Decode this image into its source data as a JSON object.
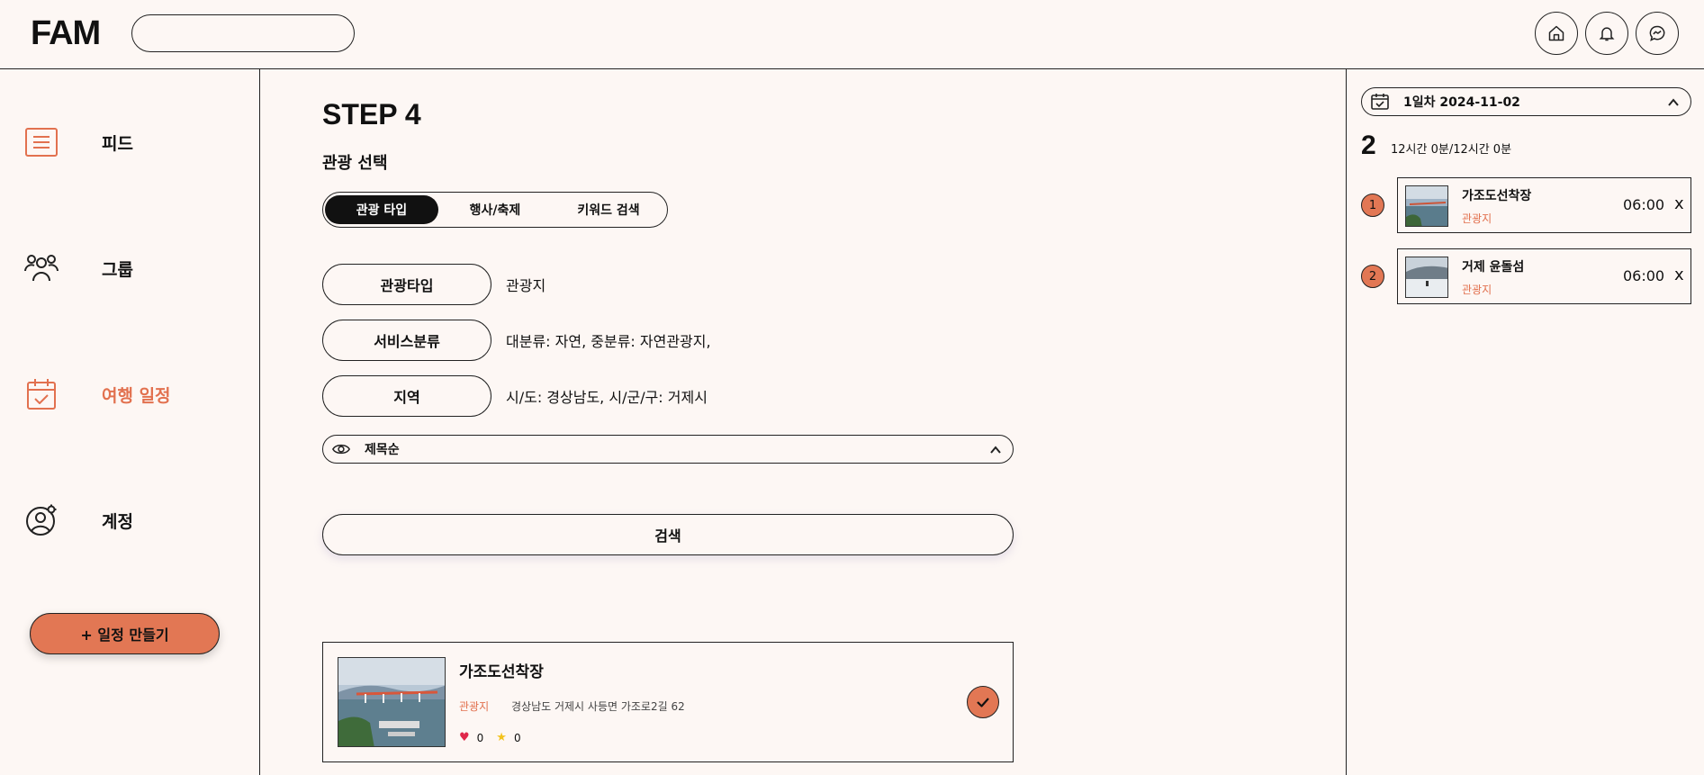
{
  "header": {
    "logo": "FAM",
    "search_placeholder": "",
    "icons": [
      "home-icon",
      "bell-icon",
      "messenger-icon"
    ]
  },
  "sidebar": {
    "items": [
      {
        "label": "피드",
        "icon": "feed-list-icon",
        "active": false
      },
      {
        "label": "그룹",
        "icon": "group-icon",
        "active": false
      },
      {
        "label": "여행 일정",
        "icon": "calendar-check-icon",
        "active": true
      },
      {
        "label": "계정",
        "icon": "account-settings-icon",
        "active": false
      }
    ],
    "create_button": "+ 일정 만들기"
  },
  "main": {
    "step_title": "STEP 4",
    "section_title": "관광 선택",
    "tabs": [
      {
        "label": "관광 타입",
        "active": true
      },
      {
        "label": "행사/축제",
        "active": false
      },
      {
        "label": "키워드 검색",
        "active": false
      }
    ],
    "filters": [
      {
        "button": "관광타입",
        "value": "관광지"
      },
      {
        "button": "서비스분류",
        "value": "대분류: 자연, 중분류: 자연관광지,"
      },
      {
        "button": "지역",
        "value": "시/도: 경상남도, 시/군/구: 거제시"
      }
    ],
    "sort_label": "제목순",
    "search_button": "검색",
    "result": {
      "title": "가조도선착장",
      "category": "관광지",
      "address": "경상남도 거제시 사등면 가조로2길 62",
      "likes": "0",
      "stars": "0"
    }
  },
  "right_panel": {
    "day_label": "1일차 2024-11-02",
    "count": "2",
    "time_info": "12시간 0분/12시간 0분",
    "items": [
      {
        "num": "1",
        "name": "가조도선착장",
        "category": "관광지",
        "time": "06:00",
        "remove": "x"
      },
      {
        "num": "2",
        "name": "거제 윤돌섬",
        "category": "관광지",
        "time": "06:00",
        "remove": "x"
      }
    ]
  },
  "colors": {
    "accent": "#e27754",
    "background": "#fdf7f4",
    "text": "#111111"
  }
}
